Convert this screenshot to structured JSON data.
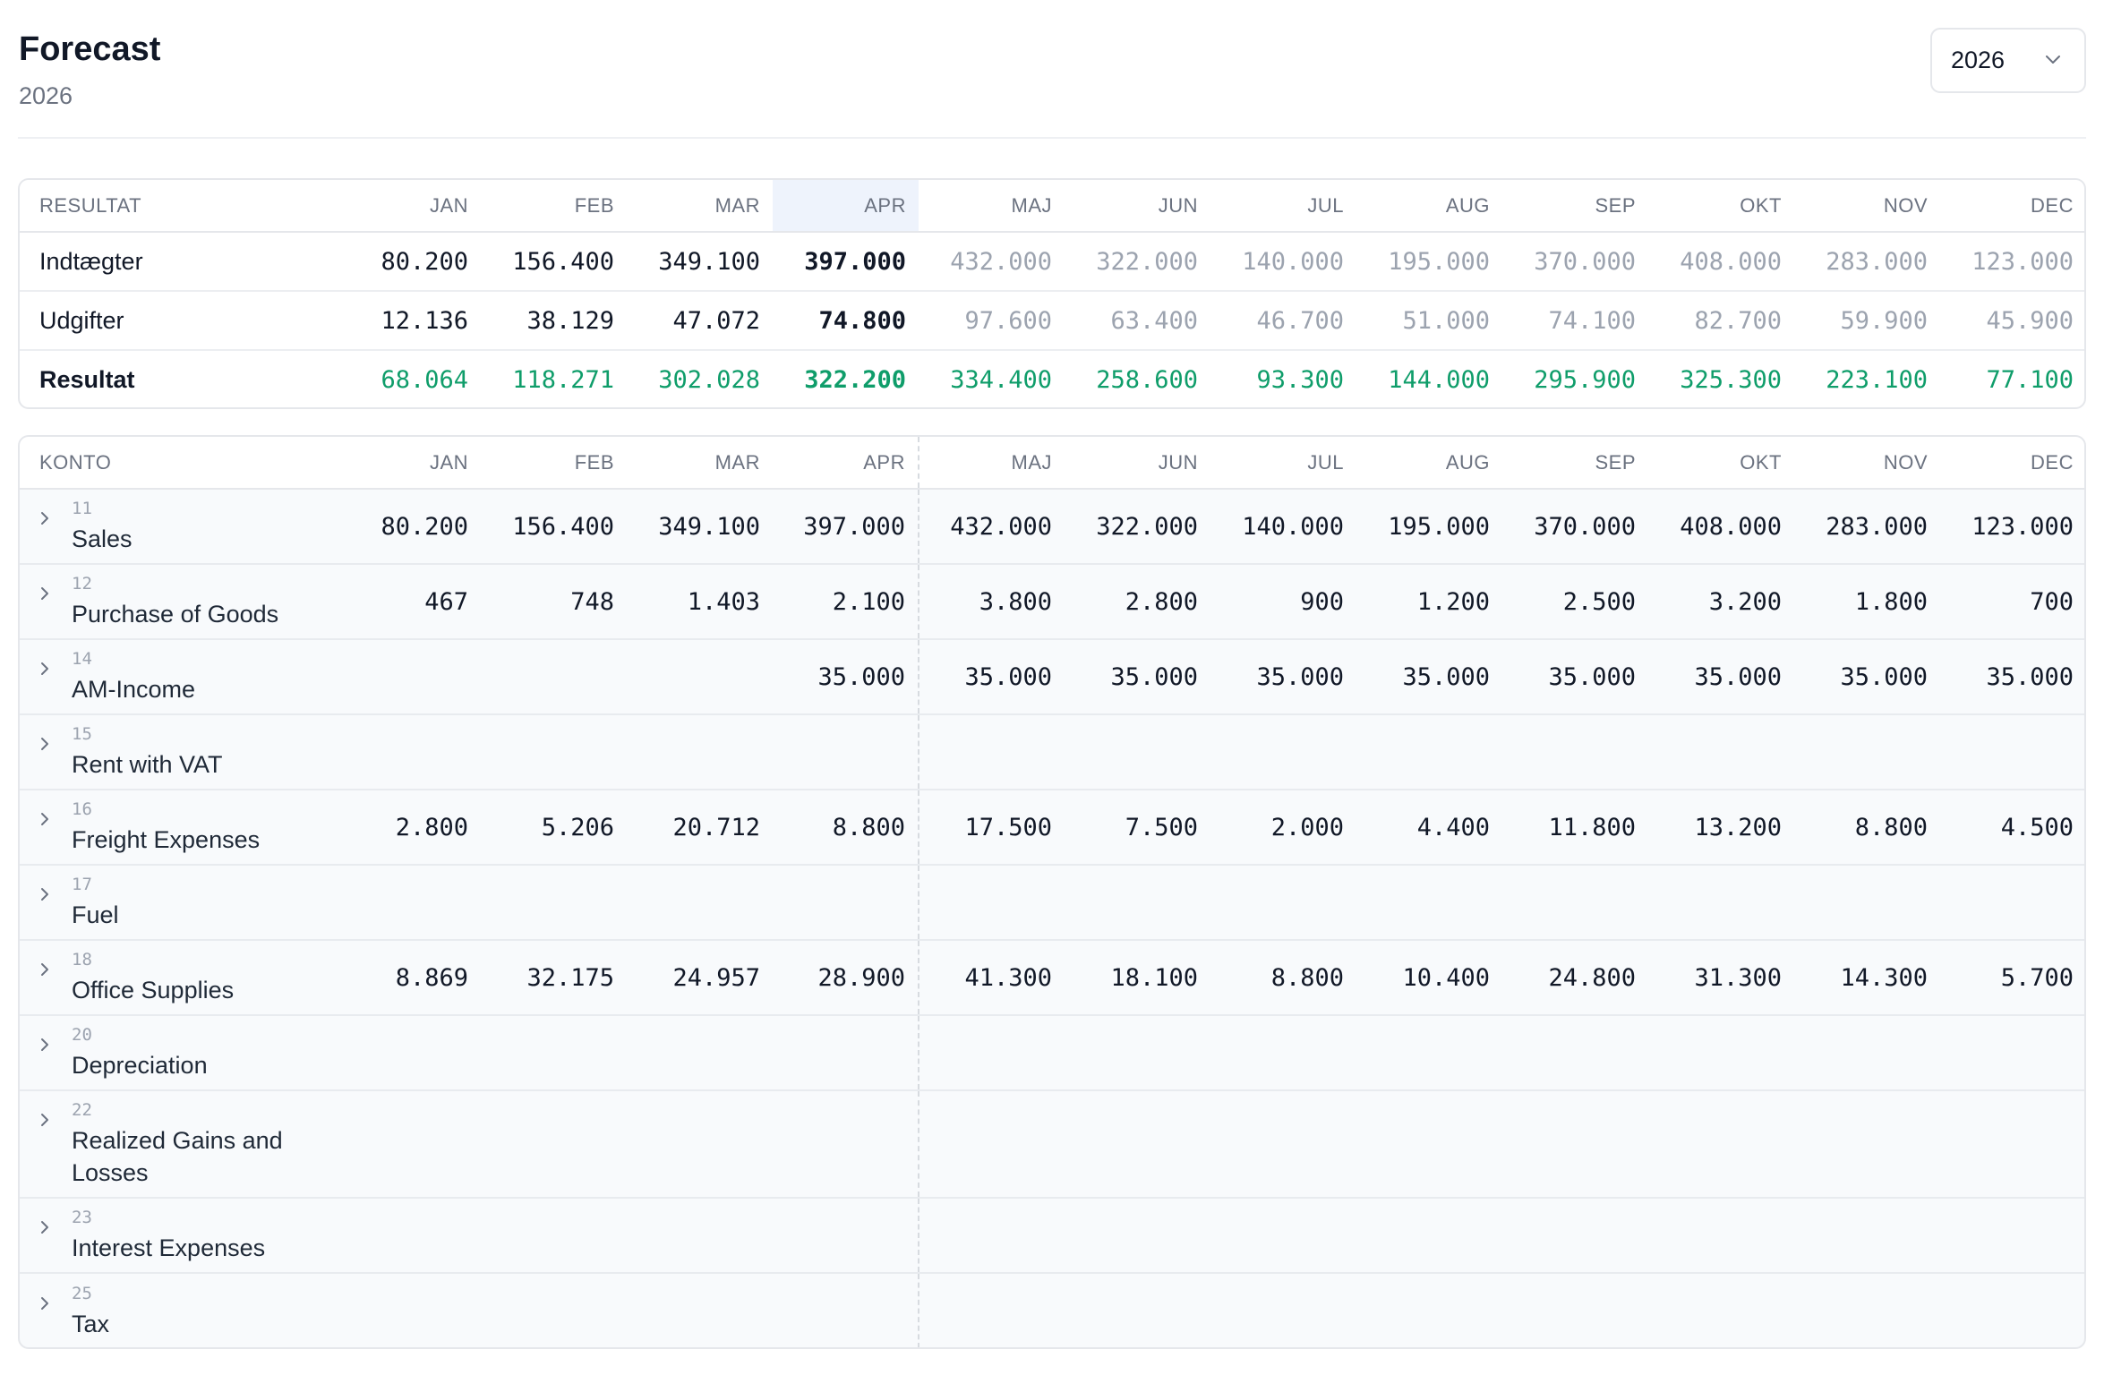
{
  "header": {
    "title": "Forecast",
    "subtitle": "2026",
    "year_select": {
      "value": "2026"
    }
  },
  "months": [
    "JAN",
    "FEB",
    "MAR",
    "APR",
    "MAJ",
    "JUN",
    "JUL",
    "AUG",
    "SEP",
    "OKT",
    "NOV",
    "DEC"
  ],
  "current_month_index": 3,
  "colors": {
    "positive": "#0f9d6a",
    "forecast": "#9ca3af",
    "current_highlight": "#eef3fc"
  },
  "summary": {
    "header_label": "RESULTAT",
    "rows": [
      {
        "label": "Indtægter",
        "bold": false,
        "style": "plain",
        "values": [
          "80.200",
          "156.400",
          "349.100",
          "397.000",
          "432.000",
          "322.000",
          "140.000",
          "195.000",
          "370.000",
          "408.000",
          "283.000",
          "123.000"
        ]
      },
      {
        "label": "Udgifter",
        "bold": false,
        "style": "plain",
        "values": [
          "12.136",
          "38.129",
          "47.072",
          "74.800",
          "97.600",
          "63.400",
          "46.700",
          "51.000",
          "74.100",
          "82.700",
          "59.900",
          "45.900"
        ]
      },
      {
        "label": "Resultat",
        "bold": true,
        "style": "positive",
        "values": [
          "68.064",
          "118.271",
          "302.028",
          "322.200",
          "334.400",
          "258.600",
          "93.300",
          "144.000",
          "295.900",
          "325.300",
          "223.100",
          "77.100"
        ]
      }
    ]
  },
  "accounts": {
    "header_label": "KONTO",
    "rows": [
      {
        "number": "11",
        "name": "Sales",
        "values": [
          "80.200",
          "156.400",
          "349.100",
          "397.000",
          "432.000",
          "322.000",
          "140.000",
          "195.000",
          "370.000",
          "408.000",
          "283.000",
          "123.000"
        ]
      },
      {
        "number": "12",
        "name": "Purchase of Goods",
        "values": [
          "467",
          "748",
          "1.403",
          "2.100",
          "3.800",
          "2.800",
          "900",
          "1.200",
          "2.500",
          "3.200",
          "1.800",
          "700"
        ]
      },
      {
        "number": "14",
        "name": "AM-Income",
        "values": [
          "",
          "",
          "",
          "35.000",
          "35.000",
          "35.000",
          "35.000",
          "35.000",
          "35.000",
          "35.000",
          "35.000",
          "35.000"
        ]
      },
      {
        "number": "15",
        "name": "Rent with VAT",
        "values": [
          "",
          "",
          "",
          "",
          "",
          "",
          "",
          "",
          "",
          "",
          "",
          ""
        ]
      },
      {
        "number": "16",
        "name": "Freight Expenses",
        "values": [
          "2.800",
          "5.206",
          "20.712",
          "8.800",
          "17.500",
          "7.500",
          "2.000",
          "4.400",
          "11.800",
          "13.200",
          "8.800",
          "4.500"
        ]
      },
      {
        "number": "17",
        "name": "Fuel",
        "values": [
          "",
          "",
          "",
          "",
          "",
          "",
          "",
          "",
          "",
          "",
          "",
          ""
        ]
      },
      {
        "number": "18",
        "name": "Office Supplies",
        "values": [
          "8.869",
          "32.175",
          "24.957",
          "28.900",
          "41.300",
          "18.100",
          "8.800",
          "10.400",
          "24.800",
          "31.300",
          "14.300",
          "5.700"
        ]
      },
      {
        "number": "20",
        "name": "Depreciation",
        "values": [
          "",
          "",
          "",
          "",
          "",
          "",
          "",
          "",
          "",
          "",
          "",
          ""
        ]
      },
      {
        "number": "22",
        "name": "Realized Gains and Losses",
        "values": [
          "",
          "",
          "",
          "",
          "",
          "",
          "",
          "",
          "",
          "",
          "",
          ""
        ]
      },
      {
        "number": "23",
        "name": "Interest Expenses",
        "values": [
          "",
          "",
          "",
          "",
          "",
          "",
          "",
          "",
          "",
          "",
          "",
          ""
        ]
      },
      {
        "number": "25",
        "name": "Tax",
        "values": [
          "",
          "",
          "",
          "",
          "",
          "",
          "",
          "",
          "",
          "",
          "",
          ""
        ]
      }
    ]
  }
}
